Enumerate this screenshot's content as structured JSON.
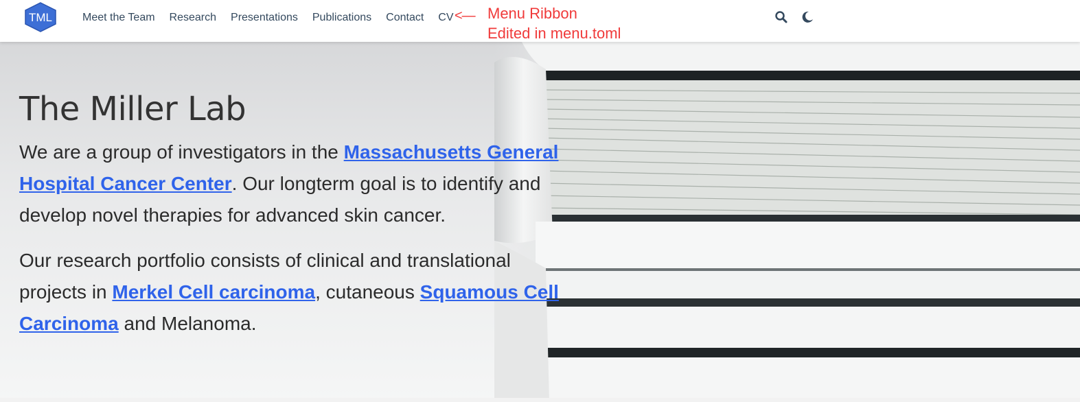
{
  "navbar": {
    "logo_text": "TML",
    "links": [
      {
        "label": "Meet the Team"
      },
      {
        "label": "Research"
      },
      {
        "label": "Presentations"
      },
      {
        "label": "Publications"
      },
      {
        "label": "Contact"
      },
      {
        "label": "CV"
      }
    ],
    "annotation_arrow": "<—",
    "annotation_line1": "Menu Ribbon",
    "annotation_line2": "Edited in menu.toml",
    "icons": [
      "search-icon",
      "moon-icon"
    ]
  },
  "hero": {
    "title": "The Miller Lab",
    "p1": {
      "before": "We are a group of investigators in the ",
      "link": "Massachusetts General Hospital Cancer Center",
      "after": ". Our longterm goal is to identify and develop novel therapies for advanced skin cancer."
    },
    "p2": {
      "before": "Our research portfolio consists of clinical and translational projects in ",
      "link1": "Merkel Cell carcinoma",
      "middle": ", cutaneous ",
      "link2": "Squamous Cell Carcinoma",
      "after": " and Melanoma."
    }
  },
  "colors": {
    "accent_link": "#2f63ea",
    "annotation": "#f03a3a",
    "logo_fill": "#3d6fd6",
    "nav_text": "#34495e"
  }
}
